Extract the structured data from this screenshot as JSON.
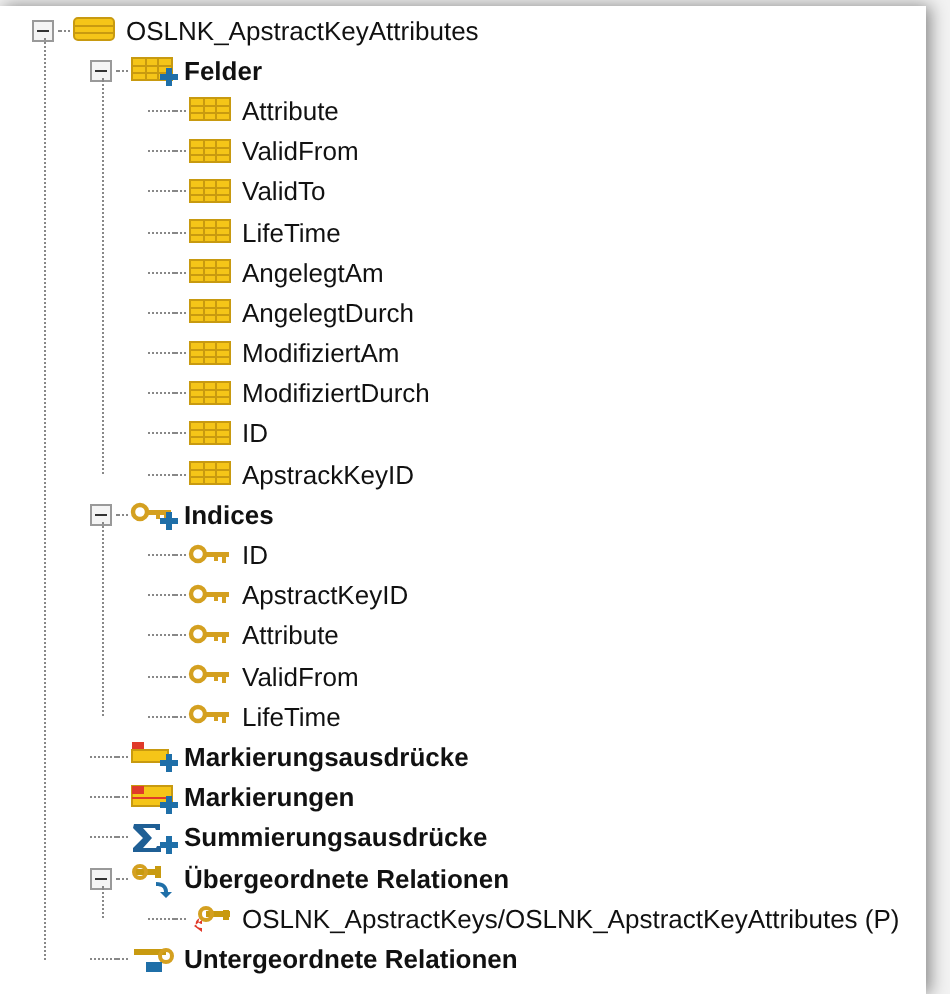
{
  "tree": {
    "label": "OSLNK_ApstractKeyAttributes",
    "kind": "table",
    "expanded": true,
    "children": [
      {
        "label": "Felder",
        "kind": "fields",
        "expanded": true,
        "children": [
          {
            "label": "Attribute",
            "kind": "field"
          },
          {
            "label": "ValidFrom",
            "kind": "field"
          },
          {
            "label": "ValidTo",
            "kind": "field"
          },
          {
            "label": "LifeTime",
            "kind": "field"
          },
          {
            "label": "AngelegtAm",
            "kind": "field"
          },
          {
            "label": "AngelegtDurch",
            "kind": "field"
          },
          {
            "label": "ModifiziertAm",
            "kind": "field"
          },
          {
            "label": "ModifiziertDurch",
            "kind": "field"
          },
          {
            "label": "ID",
            "kind": "field"
          },
          {
            "label": "ApstrackKeyID",
            "kind": "field"
          }
        ]
      },
      {
        "label": "Indices",
        "kind": "indices",
        "expanded": true,
        "children": [
          {
            "label": "ID",
            "kind": "key"
          },
          {
            "label": "ApstractKeyID",
            "kind": "key"
          },
          {
            "label": "Attribute",
            "kind": "key"
          },
          {
            "label": "ValidFrom",
            "kind": "key"
          },
          {
            "label": "LifeTime",
            "kind": "key"
          }
        ]
      },
      {
        "label": "Markierungsausdrücke",
        "kind": "mark-expressions"
      },
      {
        "label": "Markierungen",
        "kind": "marks"
      },
      {
        "label": "Summierungsausdrücke",
        "kind": "sums"
      },
      {
        "label": "Übergeordnete Relationen",
        "kind": "parent-relations",
        "expanded": true,
        "children": [
          {
            "label": "OSLNK_ApstractKeys/OSLNK_ApstractKeyAttributes (P)",
            "kind": "relation"
          }
        ]
      },
      {
        "label": "Untergeordnete Relationen",
        "kind": "child-relations"
      }
    ]
  }
}
